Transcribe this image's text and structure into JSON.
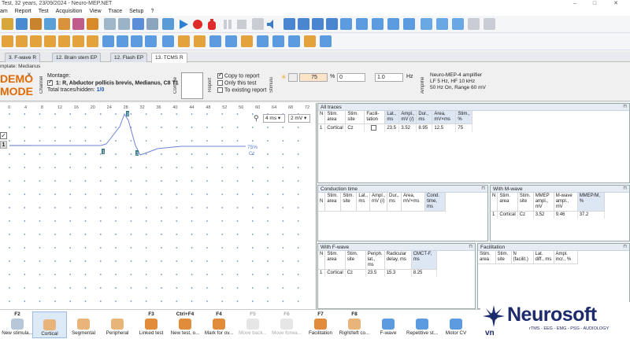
{
  "window": {
    "title": "Test, 32 years, 23/09/2024 - Neuro-MEP.NET"
  },
  "menu": [
    "am",
    "Report",
    "Test",
    "Acquisition",
    "View",
    "Trace",
    "Setup",
    "?"
  ],
  "tabs": [
    {
      "label": "3. F-wave R",
      "active": false
    },
    {
      "label": "12. Brain stem EP",
      "active": false
    },
    {
      "label": "12. Flash EP",
      "active": false
    },
    {
      "label": "13. TCMS R",
      "active": true
    }
  ],
  "template": {
    "label": "mplate: Medianus"
  },
  "controls": {
    "demo_line1": "DEMO",
    "demo_line2": "MODE",
    "channel_label": "Channel",
    "montage_label": "Montage:",
    "montage_value": "1: R, Abductor pollicis brevis, Medianus, C8 T1",
    "traces_label": "Total traces/hidden: ",
    "traces_value": "1/0",
    "comment_label": "Comme",
    "report_label": "Report",
    "copy_to_report": "Copy to report",
    "only_this_test": "Only this test",
    "to_existing_report": "To existing report",
    "stimulus_label": "Stimulu",
    "intensity": "75",
    "percent": "%",
    "offset": "0",
    "freq": "1.0",
    "hz": "Hz",
    "amplifier_label": "Amplifie",
    "amp_name": "Neuro-MEP-4 amplifier",
    "amp_filters": "LF  5 Hz, HF  10 kHz",
    "amp_range": "50 Hz  On, Range 60 mV"
  },
  "trace": {
    "x_ticks": [
      "0",
      "4",
      "8",
      "12",
      "16",
      "20",
      "24",
      "28",
      "32",
      "36",
      "40",
      "44",
      "48",
      "52",
      "56",
      "60",
      "64",
      "68",
      "72"
    ],
    "timebase": "4 ms",
    "sensitivity": "2 mV",
    "channel_number": "1",
    "trace_tag": "75%",
    "trace_site": "Cz",
    "markers": [
      "1",
      "2",
      "3"
    ]
  },
  "all_traces": {
    "title": "All traces",
    "headers": [
      "N",
      "Stim. area",
      "Stim. site",
      "Facili-tation",
      "Lat., ms",
      "Ampl., mV (/)",
      "Dur., ms",
      "Area, mV×ms",
      "Stim., %"
    ],
    "rows": [
      [
        "1",
        "Cortical",
        "Cz",
        "",
        "23.5",
        "3.52",
        "8.95",
        "12.5",
        "75"
      ]
    ]
  },
  "conduction_time": {
    "title": "Conduction time",
    "headers": [
      "N",
      "Stim. area",
      "Stim. site",
      "Lat., ms",
      "Ampl., mV (/)",
      "Dur., ms",
      "Area, mV×ms",
      "Cond. time, ms"
    ]
  },
  "with_mwave": {
    "title": "With M-wave",
    "headers": [
      "N",
      "Stim. area",
      "Stim. site",
      "MMEP ampl., mV",
      "M-wave ampl., mV",
      "MMEP/M, %"
    ],
    "rows": [
      [
        "1",
        "Cortical",
        "Cz",
        "3.52",
        "9.46",
        "37.2"
      ]
    ]
  },
  "with_fwave": {
    "title": "With F-wave",
    "headers": [
      "N",
      "Stim. area",
      "Stim. site",
      "Periph. lat., ms",
      "Radicular delay, ms",
      "CMCT-F, ms"
    ],
    "rows": [
      [
        "1",
        "Cortical",
        "Cz",
        "23.5",
        "15.3",
        "8.25"
      ]
    ]
  },
  "facilitation": {
    "title": "Facilitation",
    "headers": [
      "Stim. area",
      "Stim. site",
      "N (facilit.)",
      "Lat. diff., ms",
      "Ampl. incr., %"
    ]
  },
  "bottom": [
    {
      "key": "F2",
      "label": "New stimula...",
      "state": "normal"
    },
    {
      "key": "",
      "label": "Cortical",
      "state": "selected"
    },
    {
      "key": "",
      "label": "Segmental",
      "state": "normal"
    },
    {
      "key": "",
      "label": "Peripheral",
      "state": "normal"
    },
    {
      "key": "F3",
      "label": "Linked test",
      "state": "normal"
    },
    {
      "key": "Ctrl+F4",
      "label": "New test, o...",
      "state": "normal"
    },
    {
      "key": "F4",
      "label": "Mark for ov...",
      "state": "normal"
    },
    {
      "key": "F5",
      "label": "Move back...",
      "state": "disabled"
    },
    {
      "key": "F6",
      "label": "Move forwa...",
      "state": "disabled"
    },
    {
      "key": "F7",
      "label": "Facilitation",
      "state": "normal"
    },
    {
      "key": "F8",
      "label": "Right/left co...",
      "state": "normal"
    },
    {
      "key": "",
      "label": "F-wave",
      "state": "normal"
    },
    {
      "key": "",
      "label": "Repetitive st...",
      "state": "normal"
    },
    {
      "key": "",
      "label": "Motor CV",
      "state": "normal"
    }
  ],
  "brand": {
    "name": "Neurosoft",
    "suffix": "vn",
    "tagline": "rTMS - EEG - EMG - PSG - AUDIOLOGY",
    "color": "#1d2a6b"
  }
}
